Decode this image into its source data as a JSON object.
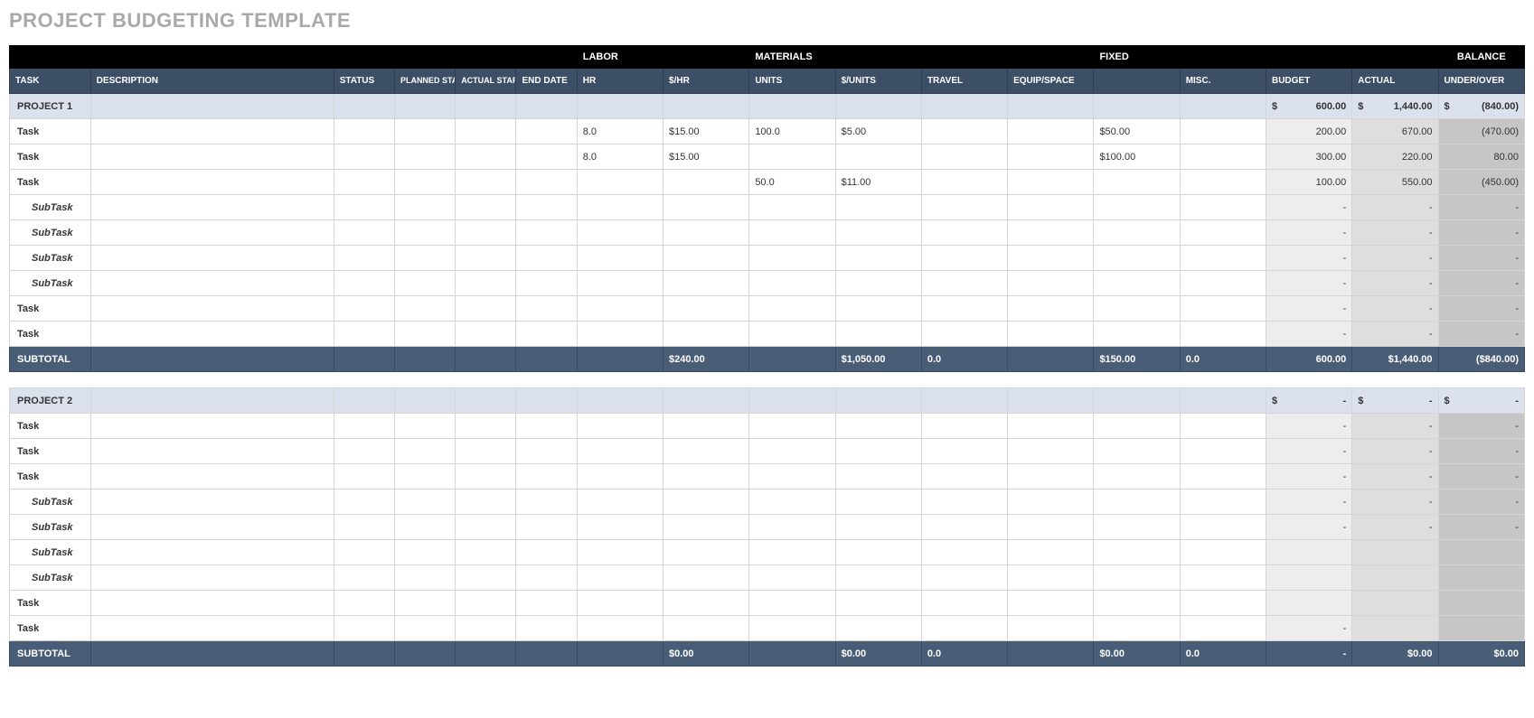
{
  "title": "PROJECT BUDGETING TEMPLATE",
  "groupHeaders": {
    "labor": "LABOR",
    "materials": "MATERIALS",
    "fixed": "FIXED",
    "balance": "BALANCE"
  },
  "columns": {
    "task": "TASK",
    "description": "DESCRIPTION",
    "status": "STATUS",
    "plannedStart": "PLANNED START DATE",
    "actualStart": "ACTUAL START DATE",
    "endDate": "END DATE",
    "hr": "HR",
    "hrRate": "$/HR",
    "units": "UNITS",
    "unitRate": "$/UNITS",
    "travel": "TRAVEL",
    "equip": "EQUIP/SPACE",
    "fixed": "",
    "misc": "MISC.",
    "budget": "BUDGET",
    "actual": "ACTUAL",
    "underOver": "UNDER/OVER"
  },
  "projects": [
    {
      "name": "PROJECT 1",
      "budget": "600.00",
      "actual": "1,440.00",
      "underOver": "(840.00)",
      "rows": [
        {
          "type": "task",
          "label": "Task",
          "hr": "8.0",
          "hrRate": "$15.00",
          "units": "100.0",
          "unitRate": "$5.00",
          "fixed": "$50.00",
          "budget": "200.00",
          "actual": "670.00",
          "underOver": "(470.00)"
        },
        {
          "type": "task",
          "label": "Task",
          "hr": "8.0",
          "hrRate": "$15.00",
          "fixed": "$100.00",
          "budget": "300.00",
          "actual": "220.00",
          "underOver": "80.00"
        },
        {
          "type": "task",
          "label": "Task",
          "units": "50.0",
          "unitRate": "$11.00",
          "budget": "100.00",
          "actual": "550.00",
          "underOver": "(450.00)"
        },
        {
          "type": "subtask",
          "label": "SubTask",
          "budget": "-",
          "actual": "-",
          "underOver": "-"
        },
        {
          "type": "subtask",
          "label": "SubTask",
          "budget": "-",
          "actual": "-",
          "underOver": "-"
        },
        {
          "type": "subtask",
          "label": "SubTask",
          "budget": "-",
          "actual": "-",
          "underOver": "-"
        },
        {
          "type": "subtask",
          "label": "SubTask",
          "budget": "-",
          "actual": "-",
          "underOver": "-"
        },
        {
          "type": "task",
          "label": "Task",
          "budget": "-",
          "actual": "-",
          "underOver": "-"
        },
        {
          "type": "task",
          "label": "Task",
          "budget": "-",
          "actual": "-",
          "underOver": "-"
        }
      ],
      "subtotal": {
        "label": "SUBTOTAL",
        "hrRate": "$240.00",
        "unitRate": "$1,050.00",
        "travel": "0.0",
        "fixed": "$150.00",
        "misc": "0.0",
        "budget": "600.00",
        "actual": "$1,440.00",
        "underOver": "($840.00)"
      }
    },
    {
      "name": "PROJECT 2",
      "budget": "-",
      "actual": "-",
      "underOver": "-",
      "rows": [
        {
          "type": "task",
          "label": "Task",
          "budget": "-",
          "actual": "-",
          "underOver": "-"
        },
        {
          "type": "task",
          "label": "Task",
          "budget": "-",
          "actual": "-",
          "underOver": "-"
        },
        {
          "type": "task",
          "label": "Task",
          "budget": "-",
          "actual": "-",
          "underOver": "-"
        },
        {
          "type": "subtask",
          "label": "SubTask",
          "budget": "-",
          "actual": "-",
          "underOver": "-"
        },
        {
          "type": "subtask",
          "label": "SubTask",
          "budget": "-",
          "actual": "-",
          "underOver": "-"
        },
        {
          "type": "subtask",
          "label": "SubTask",
          "budget": "",
          "actual": "",
          "underOver": ""
        },
        {
          "type": "subtask",
          "label": "SubTask",
          "budget": "",
          "actual": "",
          "underOver": ""
        },
        {
          "type": "task",
          "label": "Task",
          "budget": "",
          "actual": "",
          "underOver": ""
        },
        {
          "type": "task",
          "label": "Task",
          "budget": "-",
          "actual": "",
          "underOver": ""
        }
      ],
      "subtotal": {
        "label": "SUBTOTAL",
        "hrRate": "$0.00",
        "unitRate": "$0.00",
        "travel": "0.0",
        "fixed": "$0.00",
        "misc": "0.0",
        "budget": "-",
        "actual": "$0.00",
        "underOver": "$0.00"
      }
    }
  ]
}
